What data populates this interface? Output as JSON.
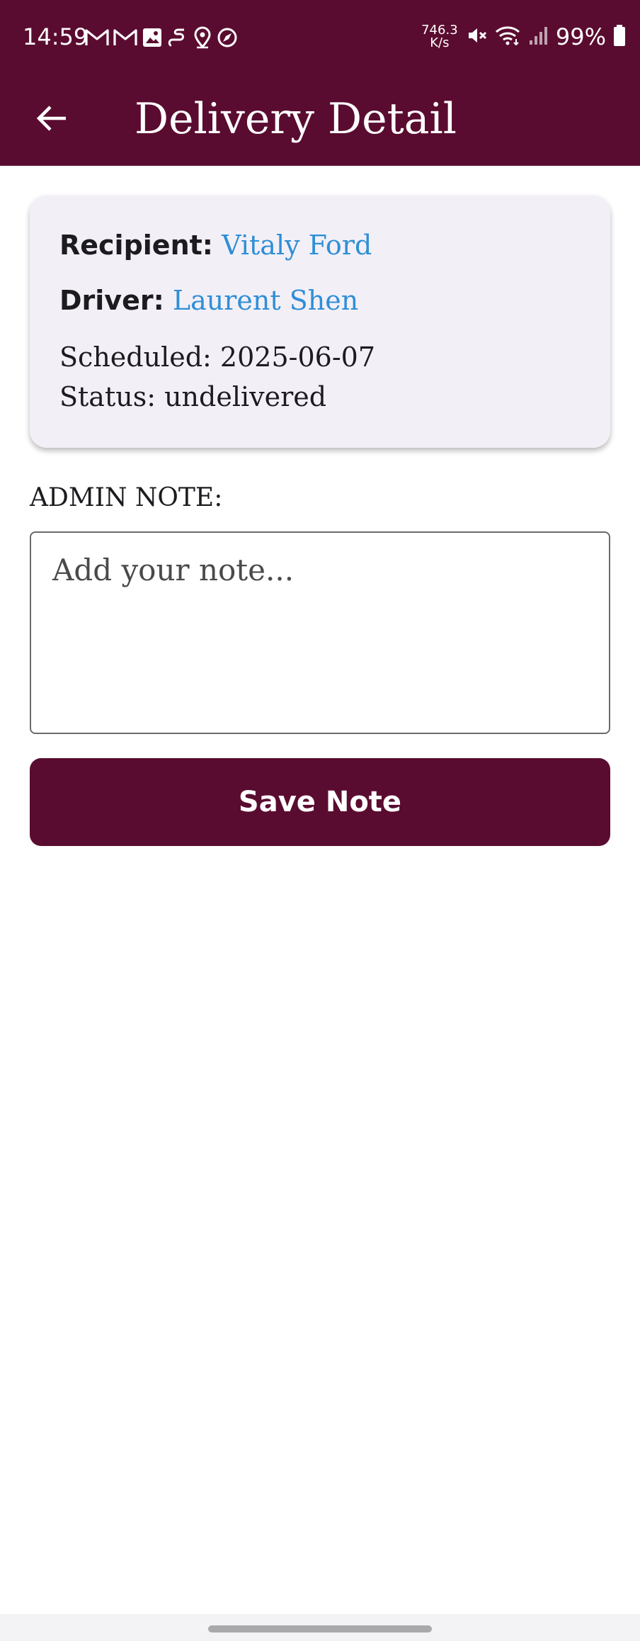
{
  "status_bar": {
    "time": "14:59",
    "net_speed_value": "746.3",
    "net_speed_unit": "K/s",
    "battery": "99%",
    "icons_left": [
      "gmail-icon",
      "gmail-icon",
      "gallery-icon",
      "link-icon",
      "location-icon",
      "navigation-icon"
    ],
    "icons_right": [
      "mute-icon",
      "wifi-icon",
      "signal-icon",
      "battery-icon"
    ]
  },
  "app_bar": {
    "title": "Delivery Detail",
    "back_icon": "arrow-left-icon"
  },
  "card": {
    "recipient_label": "Recipient:",
    "recipient_name": "Vitaly Ford",
    "driver_label": "Driver:",
    "driver_name": "Laurent Shen",
    "scheduled": "Scheduled: 2025-06-07",
    "status": "Status: undelivered"
  },
  "note": {
    "label": "ADMIN NOTE:",
    "value": "",
    "placeholder": "Add your note..."
  },
  "save_button_label": "Save Note",
  "colors": {
    "primary": "#5a0c30",
    "link": "#2e8fd6",
    "card_bg": "#f3eff7"
  }
}
